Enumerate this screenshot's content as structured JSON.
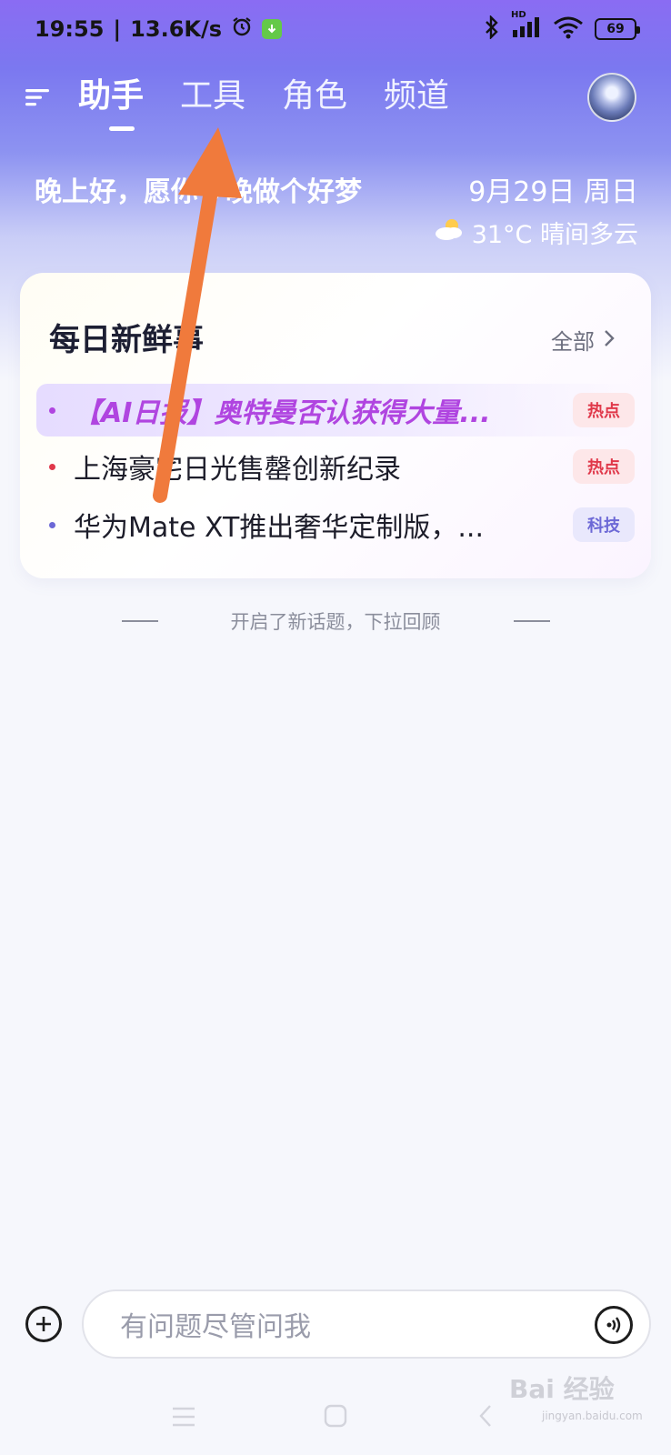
{
  "status_bar": {
    "time": "19:55",
    "net_speed": "13.6K/s",
    "battery": "69",
    "hd_label": "HD"
  },
  "header": {
    "tabs": [
      {
        "label": "助手",
        "active": true
      },
      {
        "label": "工具",
        "active": false
      },
      {
        "label": "角色",
        "active": false
      },
      {
        "label": "频道",
        "active": false
      }
    ]
  },
  "greeting": {
    "text": "晚上好，愿你今晚做个好梦",
    "date": "9月29日 周日",
    "weather": "31°C 晴间多云"
  },
  "news_card": {
    "title": "每日新鲜事",
    "all_label": "全部",
    "items": [
      {
        "text": "【AI日报】奥特曼否认获得大量...",
        "tag": "热点",
        "bullet_color": "#b045e0"
      },
      {
        "text": "上海豪宅日光售罄创新纪录",
        "tag": "热点",
        "bullet_color": "#e0384a"
      },
      {
        "text": "华为Mate XT推出奢华定制版，...",
        "tag": "科技",
        "bullet_color": "#6c68d6"
      }
    ]
  },
  "divider_text": "开启了新话题，下拉回顾",
  "input": {
    "placeholder": "有问题尽管问我"
  },
  "watermark": {
    "brand": "Bai 经验",
    "url": "jingyan.baidu.com"
  },
  "colors": {
    "accent": "#7b78f0",
    "hot_tag": "#e0384a",
    "tech_tag": "#6c68d6",
    "highlight_text": "#b045e0",
    "arrow": "#f07a3c"
  }
}
